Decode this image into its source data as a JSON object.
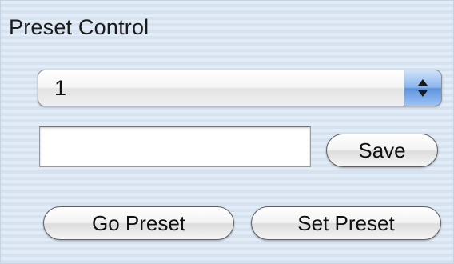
{
  "panel": {
    "title": "Preset Control"
  },
  "preset_select": {
    "selected_value": "1",
    "options": [
      "1"
    ]
  },
  "name_field": {
    "value": "",
    "placeholder": ""
  },
  "buttons": {
    "save_label": "Save",
    "go_preset_label": "Go Preset",
    "set_preset_label": "Set Preset"
  },
  "icons": {
    "popup_stepper": "up-down-arrows-icon"
  },
  "colors": {
    "background": "#dde8f4",
    "stepper_blue": "#5f93dd",
    "text": "#111111"
  }
}
